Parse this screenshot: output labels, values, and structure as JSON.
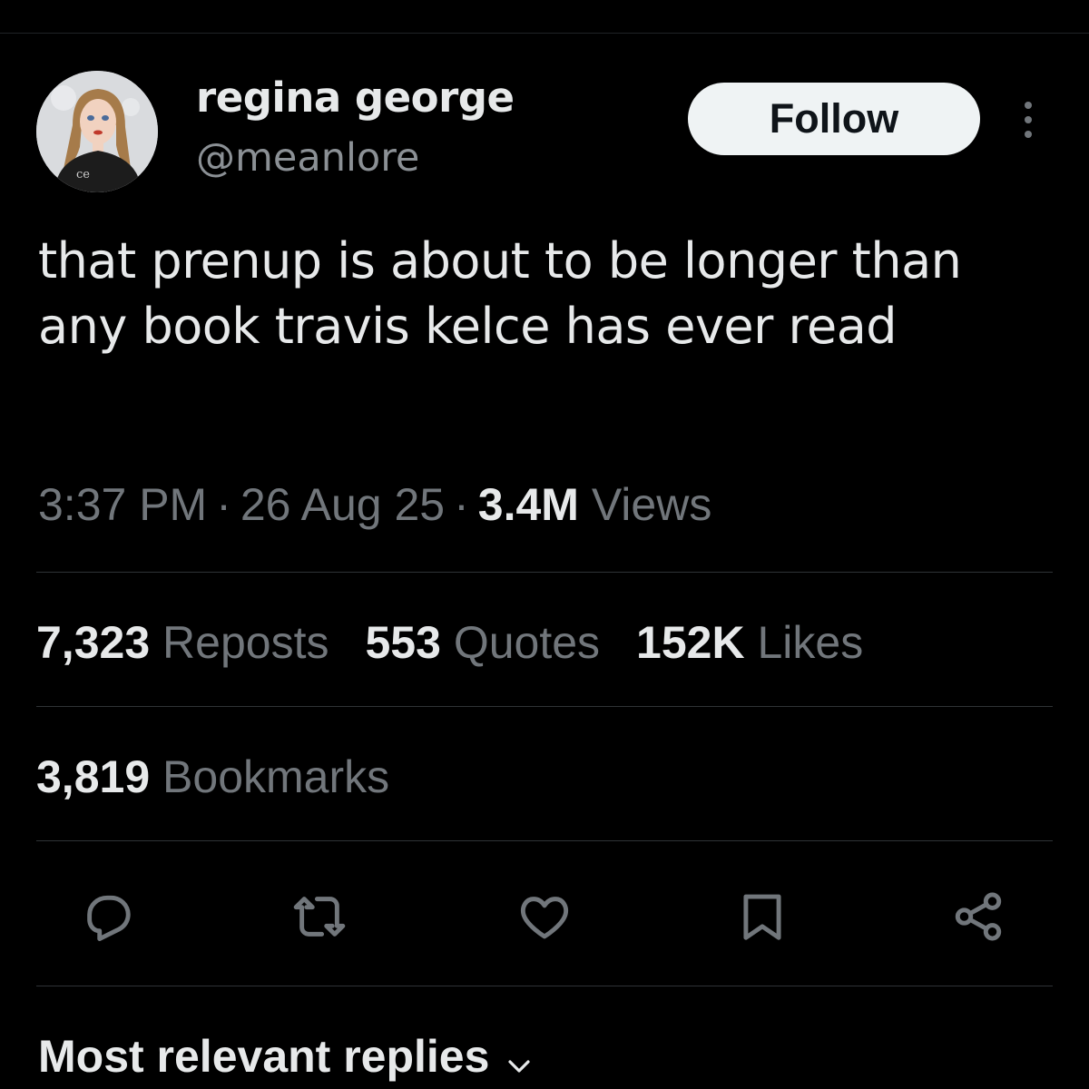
{
  "tweet": {
    "author": {
      "display_name": "regina george",
      "handle": "@meanlore"
    },
    "follow_label": "Follow",
    "text": "that prenup is about to be longer than any book travis kelce has ever read",
    "time": "3:37 PM",
    "date": "26 Aug 25",
    "views_count": "3.4M",
    "views_label": "Views",
    "separator": "·"
  },
  "stats": {
    "reposts": {
      "count": "7,323",
      "label": "Reposts"
    },
    "quotes": {
      "count": "553",
      "label": "Quotes"
    },
    "likes": {
      "count": "152K",
      "label": "Likes"
    },
    "bookmarks": {
      "count": "3,819",
      "label": "Bookmarks"
    }
  },
  "actions": {
    "icons": [
      "reply-icon",
      "repost-icon",
      "like-icon",
      "bookmark-icon",
      "share-icon"
    ]
  },
  "replies": {
    "sort_label": "Most relevant replies"
  },
  "colors": {
    "background": "#000000",
    "text_primary": "#e7e9ea",
    "text_secondary": "#71767b",
    "divider": "#2f3336",
    "follow_button_bg": "#eff3f4",
    "follow_button_text": "#0f1419"
  }
}
